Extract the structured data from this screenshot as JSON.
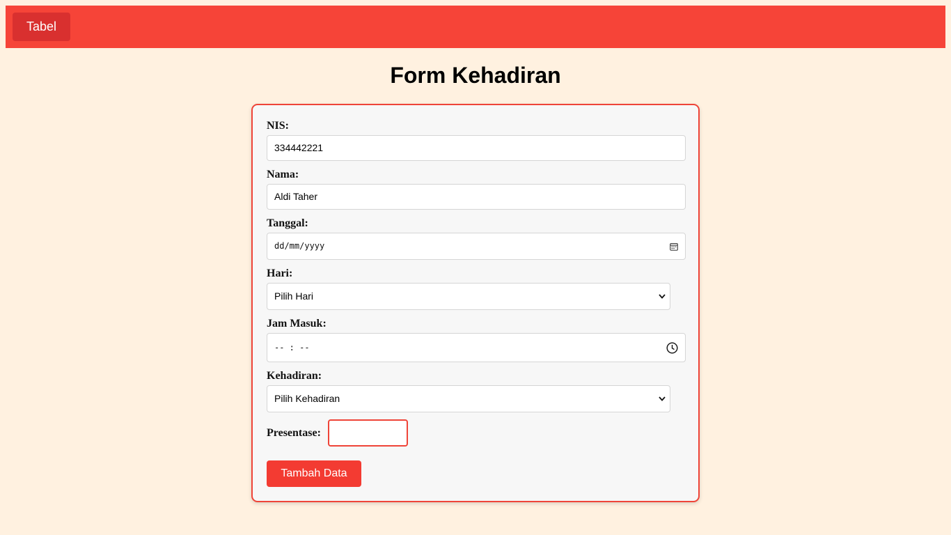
{
  "topbar": {
    "tabel_label": "Tabel",
    "color": "#f64438"
  },
  "page_title": "Form Kehadiran",
  "form": {
    "nis": {
      "label": "NIS:",
      "value": "334442221"
    },
    "nama": {
      "label": "Nama:",
      "value": "Aldi Taher"
    },
    "tanggal": {
      "label": "Tanggal:",
      "placeholder": "dd/mm/yyyy",
      "icon": "calendar-icon"
    },
    "hari": {
      "label": "Hari:",
      "selected": "Pilih Hari",
      "icon": "chevron-down-icon"
    },
    "jam_masuk": {
      "label": "Jam Masuk:",
      "placeholder": "-- : --",
      "icon": "clock-icon"
    },
    "kehadiran": {
      "label": "Kehadiran:",
      "selected": "Pilih Kehadiran",
      "icon": "chevron-down-icon"
    },
    "presentase": {
      "label": "Presentase:",
      "value": ""
    },
    "submit_label": "Tambah Data"
  },
  "colors": {
    "background": "#fff1e0",
    "accent": "#f64438",
    "button_dark": "#d9302f",
    "card_border": "#ef4438"
  }
}
